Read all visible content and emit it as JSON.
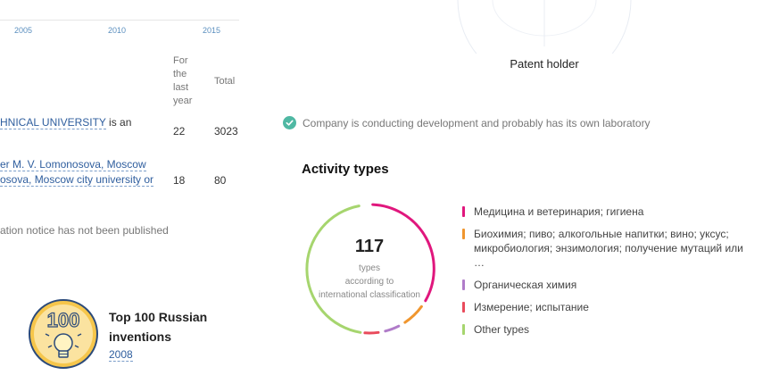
{
  "timeline": {
    "years": [
      "2005",
      "2010",
      "2015"
    ]
  },
  "table": {
    "headers": {
      "last_year": "For the last year",
      "total": "Total"
    },
    "rows": [
      {
        "pre": "",
        "link": "HNICAL UNIVERSITY",
        "post": " is an",
        "line2": "",
        "last_year": "22",
        "total": "3023"
      },
      {
        "pre": "",
        "link": "er M. V. Lomonosova, Moscow",
        "post": "",
        "line2": "osova, Moscow city university or",
        "last_year": "18",
        "total": "80"
      }
    ],
    "notice": "ation notice has not been published"
  },
  "patent_holder": {
    "label": "Patent holder"
  },
  "lab_status": {
    "text": "Company is conducting development and probably has its own laboratory"
  },
  "activity": {
    "title": "Activity types",
    "count": "117",
    "count_label_1": "types",
    "count_label_2": "according to",
    "count_label_3": "international classification",
    "legend": [
      {
        "label": "Медицина и ветеринария; гигиена",
        "color": "#e0177d"
      },
      {
        "label": "Биохимия; пиво; алкогольные напитки; вино; уксус; микробиология; энзимология; получение мутаций или …",
        "color": "#f0962e"
      },
      {
        "label": "Органическая химия",
        "color": "#b07cc9"
      },
      {
        "label": "Измерение; испытание",
        "color": "#e94b5c"
      },
      {
        "label": "Other types",
        "color": "#a6d56e"
      }
    ]
  },
  "award": {
    "badge": "100",
    "title": "Top 100 Russian inventions",
    "year": "2008"
  }
}
